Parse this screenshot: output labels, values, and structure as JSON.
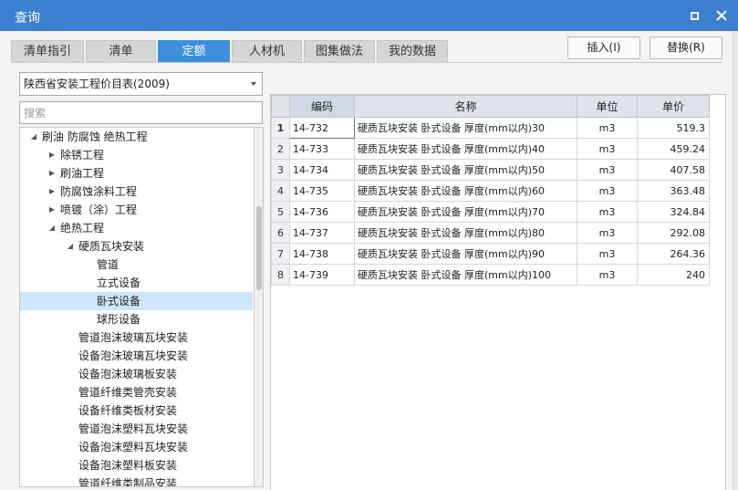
{
  "window": {
    "title": "查询"
  },
  "tabs": [
    {
      "label": "清单指引"
    },
    {
      "label": "清单"
    },
    {
      "label": "定额"
    },
    {
      "label": "人材机"
    },
    {
      "label": "图集做法"
    },
    {
      "label": "我的数据"
    }
  ],
  "actions": {
    "insert_label": "插入(I)",
    "replace_label": "替换(R)"
  },
  "left": {
    "library": "陕西省安装工程价目表(2009)",
    "search_placeholder": "搜索",
    "tree": [
      {
        "label": "刷油 防腐蚀 绝热工程",
        "indent": 0,
        "expand": "open"
      },
      {
        "label": "除锈工程",
        "indent": 1,
        "expand": "closed"
      },
      {
        "label": "刷油工程",
        "indent": 1,
        "expand": "closed"
      },
      {
        "label": "防腐蚀涂料工程",
        "indent": 1,
        "expand": "closed"
      },
      {
        "label": "喷镀（涂）工程",
        "indent": 1,
        "expand": "closed"
      },
      {
        "label": "绝热工程",
        "indent": 1,
        "expand": "open"
      },
      {
        "label": "硬质瓦块安装",
        "indent": 2,
        "expand": "open"
      },
      {
        "label": "管道",
        "indent": 3,
        "expand": "none"
      },
      {
        "label": "立式设备",
        "indent": 3,
        "expand": "none"
      },
      {
        "label": "卧式设备",
        "indent": 3,
        "expand": "none",
        "selected": true
      },
      {
        "label": "球形设备",
        "indent": 3,
        "expand": "none"
      },
      {
        "label": "管道泡沫玻璃瓦块安装",
        "indent": 2,
        "expand": "none"
      },
      {
        "label": "设备泡沫玻璃瓦块安装",
        "indent": 2,
        "expand": "none"
      },
      {
        "label": "设备泡沫玻璃板安装",
        "indent": 2,
        "expand": "none"
      },
      {
        "label": "管道纤维类管壳安装",
        "indent": 2,
        "expand": "none"
      },
      {
        "label": "设备纤维类板材安装",
        "indent": 2,
        "expand": "none"
      },
      {
        "label": "管道泡沫塑料瓦块安装",
        "indent": 2,
        "expand": "none"
      },
      {
        "label": "设备泡沫塑料瓦块安装",
        "indent": 2,
        "expand": "none"
      },
      {
        "label": "设备泡沫塑料板安装",
        "indent": 2,
        "expand": "none"
      },
      {
        "label": "管道纤维类制品安装",
        "indent": 2,
        "expand": "none"
      }
    ]
  },
  "grid": {
    "headers": {
      "code": "编码",
      "name": "名称",
      "unit": "单位",
      "price": "单价"
    },
    "rows": [
      {
        "no": "1",
        "code": "14-732",
        "name": "硬质瓦块安装 卧式设备 厚度(mm以内)30",
        "unit": "m3",
        "price": "519.3"
      },
      {
        "no": "2",
        "code": "14-733",
        "name": "硬质瓦块安装 卧式设备 厚度(mm以内)40",
        "unit": "m3",
        "price": "459.24"
      },
      {
        "no": "3",
        "code": "14-734",
        "name": "硬质瓦块安装 卧式设备 厚度(mm以内)50",
        "unit": "m3",
        "price": "407.58"
      },
      {
        "no": "4",
        "code": "14-735",
        "name": "硬质瓦块安装 卧式设备 厚度(mm以内)60",
        "unit": "m3",
        "price": "363.48"
      },
      {
        "no": "5",
        "code": "14-736",
        "name": "硬质瓦块安装 卧式设备 厚度(mm以内)70",
        "unit": "m3",
        "price": "324.84"
      },
      {
        "no": "6",
        "code": "14-737",
        "name": "硬质瓦块安装 卧式设备 厚度(mm以内)80",
        "unit": "m3",
        "price": "292.08"
      },
      {
        "no": "7",
        "code": "14-738",
        "name": "硬质瓦块安装 卧式设备 厚度(mm以内)90",
        "unit": "m3",
        "price": "264.36"
      },
      {
        "no": "8",
        "code": "14-739",
        "name": "硬质瓦块安装 卧式设备 厚度(mm以内)100",
        "unit": "m3",
        "price": "240"
      }
    ]
  },
  "colors": {
    "titlebar": "#3b7fd1",
    "active_tab": "#3b8fdb",
    "selection": "#cde6fb"
  }
}
